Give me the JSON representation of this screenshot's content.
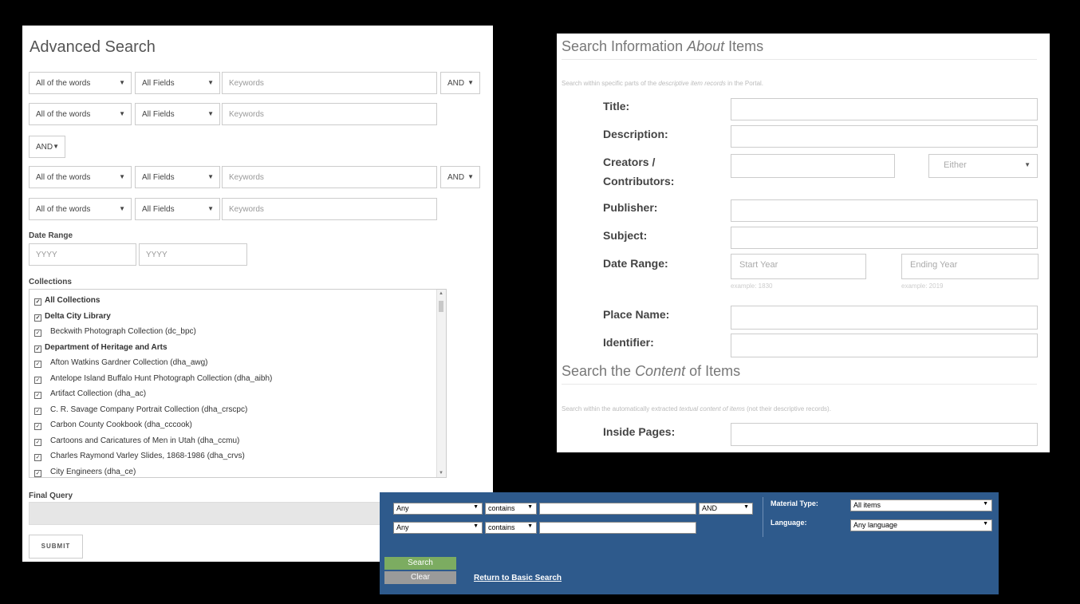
{
  "advanced": {
    "title": "Advanced Search",
    "rows": [
      {
        "scope": "All of the words",
        "field": "All Fields",
        "keyword_placeholder": "Keywords",
        "op": "AND"
      },
      {
        "scope": "All of the words",
        "field": "All Fields",
        "keyword_placeholder": "Keywords"
      },
      {
        "scope": "All of the words",
        "field": "All Fields",
        "keyword_placeholder": "Keywords",
        "op": "AND"
      },
      {
        "scope": "All of the words",
        "field": "All Fields",
        "keyword_placeholder": "Keywords"
      }
    ],
    "group_op": "AND",
    "date_range_label": "Date Range",
    "date_from_placeholder": "YYYY",
    "date_to_placeholder": "YYYY",
    "collections_label": "Collections",
    "collections": [
      {
        "label": "All Collections",
        "bold": true
      },
      {
        "label": "Delta City Library",
        "bold": true
      },
      {
        "label": "Beckwith Photograph Collection (dc_bpc)",
        "bold": false
      },
      {
        "label": "Department of Heritage and Arts",
        "bold": true
      },
      {
        "label": "Afton Watkins Gardner Collection (dha_awg)",
        "bold": false
      },
      {
        "label": "Antelope Island Buffalo Hunt Photograph Collection (dha_aibh)",
        "bold": false
      },
      {
        "label": "Artifact Collection (dha_ac)",
        "bold": false
      },
      {
        "label": "C. R. Savage Company Portrait Collection (dha_crscpc)",
        "bold": false
      },
      {
        "label": "Carbon County Cookbook (dha_cccook)",
        "bold": false
      },
      {
        "label": "Cartoons and Caricatures of Men in Utah (dha_ccmu)",
        "bold": false
      },
      {
        "label": "Charles Raymond Varley Slides, 1868-1986 (dha_crvs)",
        "bold": false
      },
      {
        "label": "City Engineers (dha_ce)",
        "bold": false
      }
    ],
    "final_query_label": "Final Query",
    "submit_label": "SUBMIT"
  },
  "about": {
    "title_pre": "Search Information ",
    "title_em": "About",
    "title_post": " Items",
    "hint_pre": "Search within specific parts of the ",
    "hint_em": "descriptive item records",
    "hint_post": " in the Portal.",
    "title_label": "Title:",
    "description_label": "Description:",
    "creators_label": "Creators /",
    "contributors_label": "Contributors:",
    "either_value": "Either",
    "publisher_label": "Publisher:",
    "subject_label": "Subject:",
    "date_range_label": "Date Range:",
    "start_placeholder": "Start Year",
    "end_placeholder": "Ending Year",
    "start_example": "example: 1830",
    "end_example": "example: 2019",
    "place_label": "Place Name:",
    "identifier_label": "Identifier:",
    "content_title_pre": "Search the ",
    "content_title_em": "Content",
    "content_title_post": " of Items",
    "content_hint_pre": "Search within the automatically extracted ",
    "content_hint_em": "textual content of items",
    "content_hint_post": " (not their descriptive records).",
    "inside_label": "Inside Pages:"
  },
  "bar": {
    "field1": "Any",
    "cond1": "contains",
    "op1": "AND",
    "field2": "Any",
    "cond2": "contains",
    "material_label": "Material Type:",
    "material_value": "All items",
    "language_label": "Language:",
    "language_value": "Any language",
    "search_label": "Search",
    "clear_label": "Clear",
    "return_link": "Return to Basic Search"
  }
}
